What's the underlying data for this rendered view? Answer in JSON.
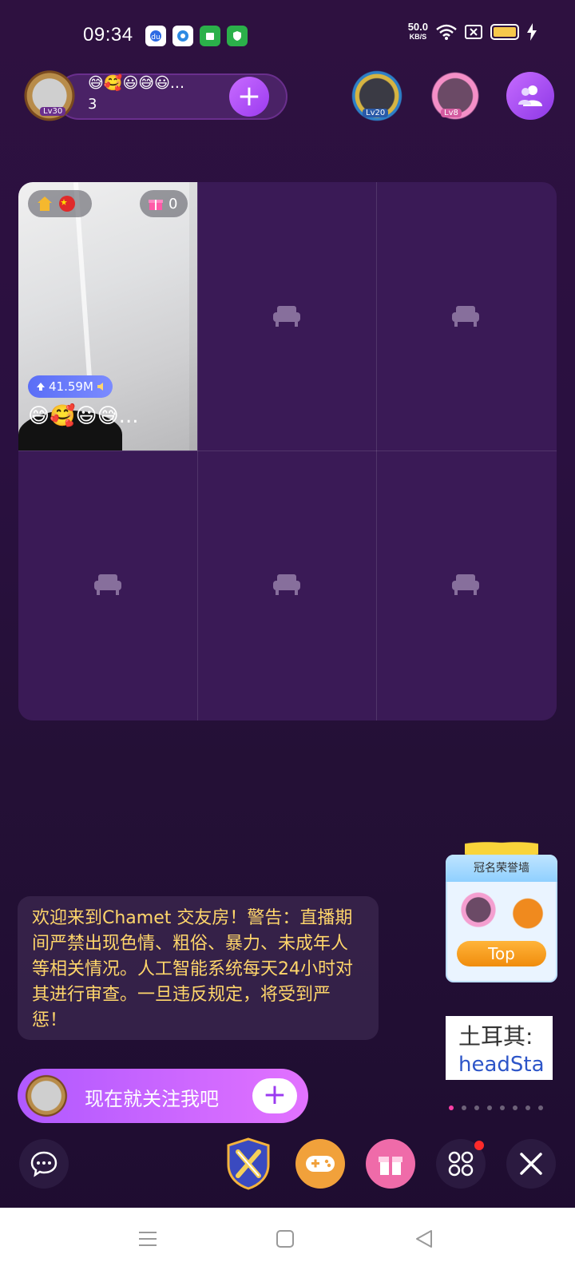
{
  "status_bar": {
    "time": "09:34",
    "net_speed": "50.0",
    "net_unit": "KB/S",
    "battery_level": 0.85,
    "icons": [
      "baidu-icon",
      "app-icon",
      "store-icon",
      "shield-icon",
      "wifi-icon",
      "sim-x-icon",
      "battery-icon",
      "charging-icon"
    ]
  },
  "host": {
    "name": "😅🥰😃😅😃...",
    "count": "3",
    "level": "Lv30",
    "follow_symbol": "+"
  },
  "viewers": [
    {
      "level": "Lv20"
    },
    {
      "level": "Lv8"
    }
  ],
  "seat": {
    "gift_count": "0",
    "score": "41.59M",
    "name": "😅🥰😃😅..."
  },
  "honor_wall": {
    "title": "冠名荣誉墙",
    "button": "Top"
  },
  "welcome": {
    "text": "欢迎来到Chamet 交友房！警告：直播期间严禁出现色情、粗俗、暴力、未成年人等相关情况。人工智能系统每天24小时对其进行审查。一旦违反规定，将受到严惩！"
  },
  "ad": {
    "line1": "土耳其:",
    "line2": "headSta"
  },
  "follow_banner": {
    "text": "现在就关注我吧",
    "symbol": "+"
  },
  "colors": {
    "accent": "#9b3bf0",
    "welcome_text": "#ffd66b",
    "background": "#2a1040"
  }
}
